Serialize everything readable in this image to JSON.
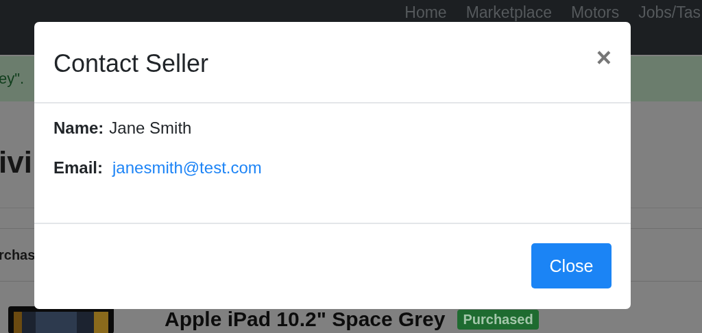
{
  "navbar": {
    "links": [
      "Home",
      "Marketplace",
      "Motors",
      "Jobs/Tas"
    ]
  },
  "background": {
    "alert": "ey\".",
    "heading": "ivi",
    "table_header": "rchas",
    "product": {
      "kind": "picture",
      "title": "Apple iPad 10.2\" Space Grey",
      "badge": "Purchased"
    }
  },
  "modal": {
    "title": "Contact Seller",
    "close_icon": "×",
    "fields": [
      {
        "label": "Name:",
        "value": "Jane Smith",
        "kind": "text"
      },
      {
        "label": "Email:",
        "value": "janesmith@test.com",
        "kind": "link"
      }
    ],
    "button": "Close"
  }
}
